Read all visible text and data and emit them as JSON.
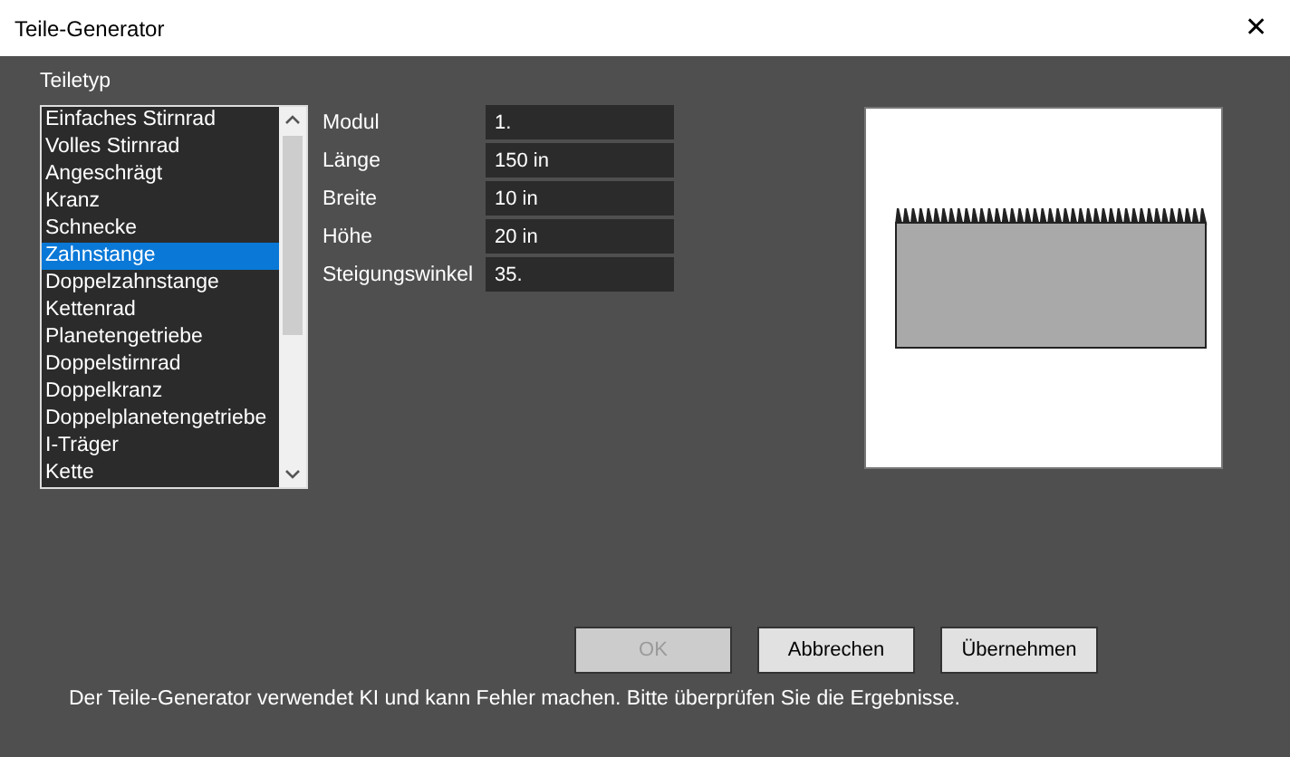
{
  "window": {
    "title": "Teile-Generator",
    "close": "✕"
  },
  "part_type": {
    "label": "Teiletyp",
    "items": [
      {
        "label": "Einfaches Stirnrad",
        "selected": false
      },
      {
        "label": "Volles Stirnrad",
        "selected": false
      },
      {
        "label": "Angeschrägt",
        "selected": false
      },
      {
        "label": "Kranz",
        "selected": false
      },
      {
        "label": "Schnecke",
        "selected": false
      },
      {
        "label": "Zahnstange",
        "selected": true
      },
      {
        "label": "Doppelzahnstange",
        "selected": false
      },
      {
        "label": "Kettenrad",
        "selected": false
      },
      {
        "label": "Planetengetriebe",
        "selected": false
      },
      {
        "label": "Doppelstirnrad",
        "selected": false
      },
      {
        "label": "Doppelkranz",
        "selected": false
      },
      {
        "label": "Doppelplanetengetriebe",
        "selected": false
      },
      {
        "label": "I-Träger",
        "selected": false
      },
      {
        "label": "Kette",
        "selected": false
      }
    ]
  },
  "parameters": [
    {
      "label": "Modul",
      "value": "1."
    },
    {
      "label": "Länge",
      "value": "150 in"
    },
    {
      "label": "Breite",
      "value": "10 in"
    },
    {
      "label": "Höhe",
      "value": "20 in"
    },
    {
      "label": "Steigungswinkel",
      "value": "35."
    }
  ],
  "buttons": [
    {
      "label": "OK",
      "disabled": true
    },
    {
      "label": "Abbrechen",
      "disabled": false
    },
    {
      "label": "Übernehmen",
      "disabled": false
    }
  ],
  "footer_note": "Der Teile-Generator verwendet KI und kann Fehler machen. Bitte überprüfen Sie die Ergebnisse."
}
